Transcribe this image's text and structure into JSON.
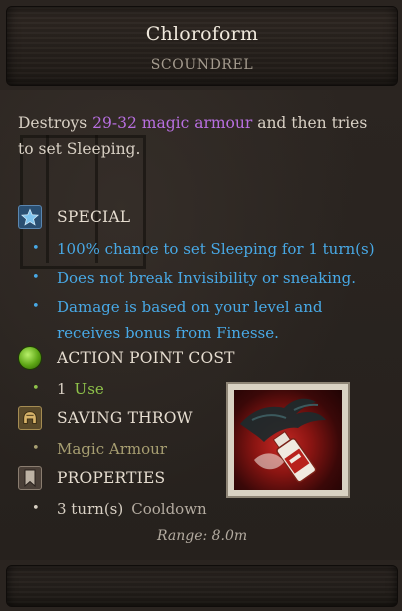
{
  "tooltip": {
    "title": "Chloroform",
    "subtitle": "SCOUNDREL",
    "description": {
      "prefix": "Destroys ",
      "highlight": "29-32 magic armour",
      "suffix": " and then tries to set Sleeping."
    },
    "colors": {
      "magic": "#b86fe0",
      "special": "#48a9e6",
      "ap": "#8fc24a",
      "saving": "#a89f72"
    },
    "sections": {
      "special": {
        "label": "SPECIAL",
        "icon": "star-icon",
        "items": [
          "100% chance to set Sleeping for 1 turn(s)",
          "Does not break Invisibility or sneaking.",
          "Damage is based on your level and receives bonus from Finesse."
        ]
      },
      "action_point_cost": {
        "label": "ACTION POINT COST",
        "icon": "green-orb-icon",
        "value": "1",
        "unit": "Use"
      },
      "saving_throw": {
        "label": "SAVING THROW",
        "icon": "helmet-icon",
        "value": "Magic Armour"
      },
      "properties": {
        "label": "PROPERTIES",
        "icon": "bookmark-icon",
        "cooldown_value": "3 turn(s)",
        "cooldown_label": "Cooldown",
        "range": "Range: 8.0m"
      }
    },
    "item_image": "chloroform-bottle-icon"
  }
}
